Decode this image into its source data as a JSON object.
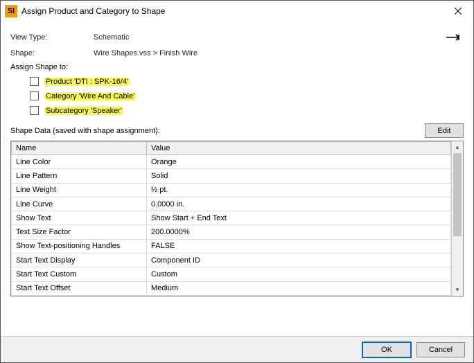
{
  "window": {
    "app_icon_text": "SI",
    "title": "Assign Product and Category to Shape"
  },
  "form": {
    "view_type_label": "View Type:",
    "view_type_value": "Schematic",
    "shape_label": "Shape:",
    "shape_value": "Wire Shapes.vss > Finish Wire",
    "assign_label": "Assign Shape to:",
    "product_label": "Product 'DTI : SPK-16/4'",
    "category_label": "Category 'Wire And Cable'",
    "subcategory_label": "Subcategory 'Speaker'"
  },
  "section": {
    "shape_data_label": "Shape Data (saved with shape assignment):",
    "edit_label": "Edit"
  },
  "table": {
    "header_name": "Name",
    "header_value": "Value",
    "rows": [
      {
        "name": "Line Color",
        "value": "Orange"
      },
      {
        "name": "Line Pattern",
        "value": "Solid"
      },
      {
        "name": "Line Weight",
        "value": "½ pt."
      },
      {
        "name": "Line Curve",
        "value": "0.0000 in."
      },
      {
        "name": "Show Text",
        "value": "Show Start + End Text"
      },
      {
        "name": "Text Size Factor",
        "value": "200.0000%"
      },
      {
        "name": "Show Text-positioning Handles",
        "value": "FALSE"
      },
      {
        "name": "Start Text Display",
        "value": "Component ID"
      },
      {
        "name": "Start Text Custom",
        "value": "Custom"
      },
      {
        "name": "Start Text Offset",
        "value": "Medium"
      }
    ]
  },
  "footer": {
    "ok_label": "OK",
    "cancel_label": "Cancel"
  }
}
